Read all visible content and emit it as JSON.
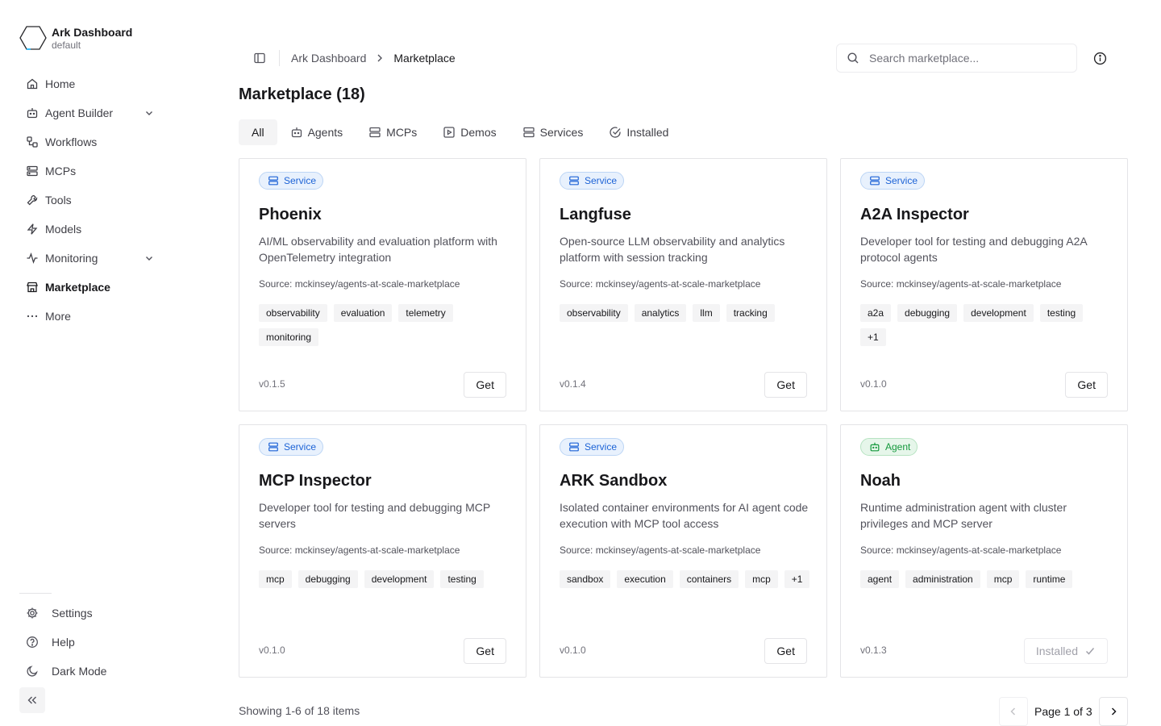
{
  "brand": {
    "title": "Ark Dashboard",
    "subtitle": "default"
  },
  "sidebar": {
    "items": [
      {
        "label": "Home",
        "icon": "home-icon"
      },
      {
        "label": "Agent Builder",
        "icon": "bot-icon",
        "expandable": true
      },
      {
        "label": "Workflows",
        "icon": "workflow-icon"
      },
      {
        "label": "MCPs",
        "icon": "server-icon"
      },
      {
        "label": "Tools",
        "icon": "wrench-icon"
      },
      {
        "label": "Models",
        "icon": "bolt-icon"
      },
      {
        "label": "Monitoring",
        "icon": "activity-icon",
        "expandable": true
      },
      {
        "label": "Marketplace",
        "icon": "store-icon",
        "active": true
      },
      {
        "label": "More",
        "icon": "more-icon"
      }
    ],
    "bottom": [
      {
        "label": "Settings",
        "icon": "gear-icon"
      },
      {
        "label": "Help",
        "icon": "help-icon"
      },
      {
        "label": "Dark Mode",
        "icon": "moon-icon"
      }
    ]
  },
  "header": {
    "breadcrumb_root": "Ark Dashboard",
    "breadcrumb_current": "Marketplace",
    "search_placeholder": "Search marketplace..."
  },
  "page": {
    "title": "Marketplace (18)"
  },
  "tabs": [
    {
      "label": "All",
      "icon": "",
      "active": true
    },
    {
      "label": "Agents",
      "icon": "bot-icon"
    },
    {
      "label": "MCPs",
      "icon": "server-icon"
    },
    {
      "label": "Demos",
      "icon": "play-icon"
    },
    {
      "label": "Services",
      "icon": "server-icon"
    },
    {
      "label": "Installed",
      "icon": "check-circle-icon"
    }
  ],
  "cards": [
    {
      "kind": "service",
      "badge": "Service",
      "title": "Phoenix",
      "description": "AI/ML observability and evaluation platform with OpenTelemetry integration",
      "source": "Source: mckinsey/agents-at-scale-marketplace",
      "tags": [
        "observability",
        "evaluation",
        "telemetry",
        "monitoring"
      ],
      "version": "v0.1.5",
      "action": "Get",
      "installed": false
    },
    {
      "kind": "service",
      "badge": "Service",
      "title": "Langfuse",
      "description": "Open-source LLM observability and analytics platform with session tracking",
      "source": "Source: mckinsey/agents-at-scale-marketplace",
      "tags": [
        "observability",
        "analytics",
        "llm",
        "tracking"
      ],
      "version": "v0.1.4",
      "action": "Get",
      "installed": false
    },
    {
      "kind": "service",
      "badge": "Service",
      "title": "A2A Inspector",
      "description": "Developer tool for testing and debugging A2A protocol agents",
      "source": "Source: mckinsey/agents-at-scale-marketplace",
      "tags": [
        "a2a",
        "debugging",
        "development",
        "testing",
        "+1"
      ],
      "version": "v0.1.0",
      "action": "Get",
      "installed": false
    },
    {
      "kind": "service",
      "badge": "Service",
      "title": "MCP Inspector",
      "description": "Developer tool for testing and debugging MCP servers",
      "source": "Source: mckinsey/agents-at-scale-marketplace",
      "tags": [
        "mcp",
        "debugging",
        "development",
        "testing"
      ],
      "version": "v0.1.0",
      "action": "Get",
      "installed": false
    },
    {
      "kind": "service",
      "badge": "Service",
      "title": "ARK Sandbox",
      "description": "Isolated container environments for AI agent code execution with MCP tool access",
      "source": "Source: mckinsey/agents-at-scale-marketplace",
      "tags": [
        "sandbox",
        "execution",
        "containers",
        "mcp",
        "+1"
      ],
      "version": "v0.1.0",
      "action": "Get",
      "installed": false
    },
    {
      "kind": "agent",
      "badge": "Agent",
      "title": "Noah",
      "description": "Runtime administration agent with cluster privileges and MCP server",
      "source": "Source: mckinsey/agents-at-scale-marketplace",
      "tags": [
        "agent",
        "administration",
        "mcp",
        "runtime"
      ],
      "version": "v0.1.3",
      "action": "Installed",
      "installed": true
    }
  ],
  "footer": {
    "showing": "Showing 1-6 of 18 items",
    "page_label": "Page 1 of 3"
  }
}
